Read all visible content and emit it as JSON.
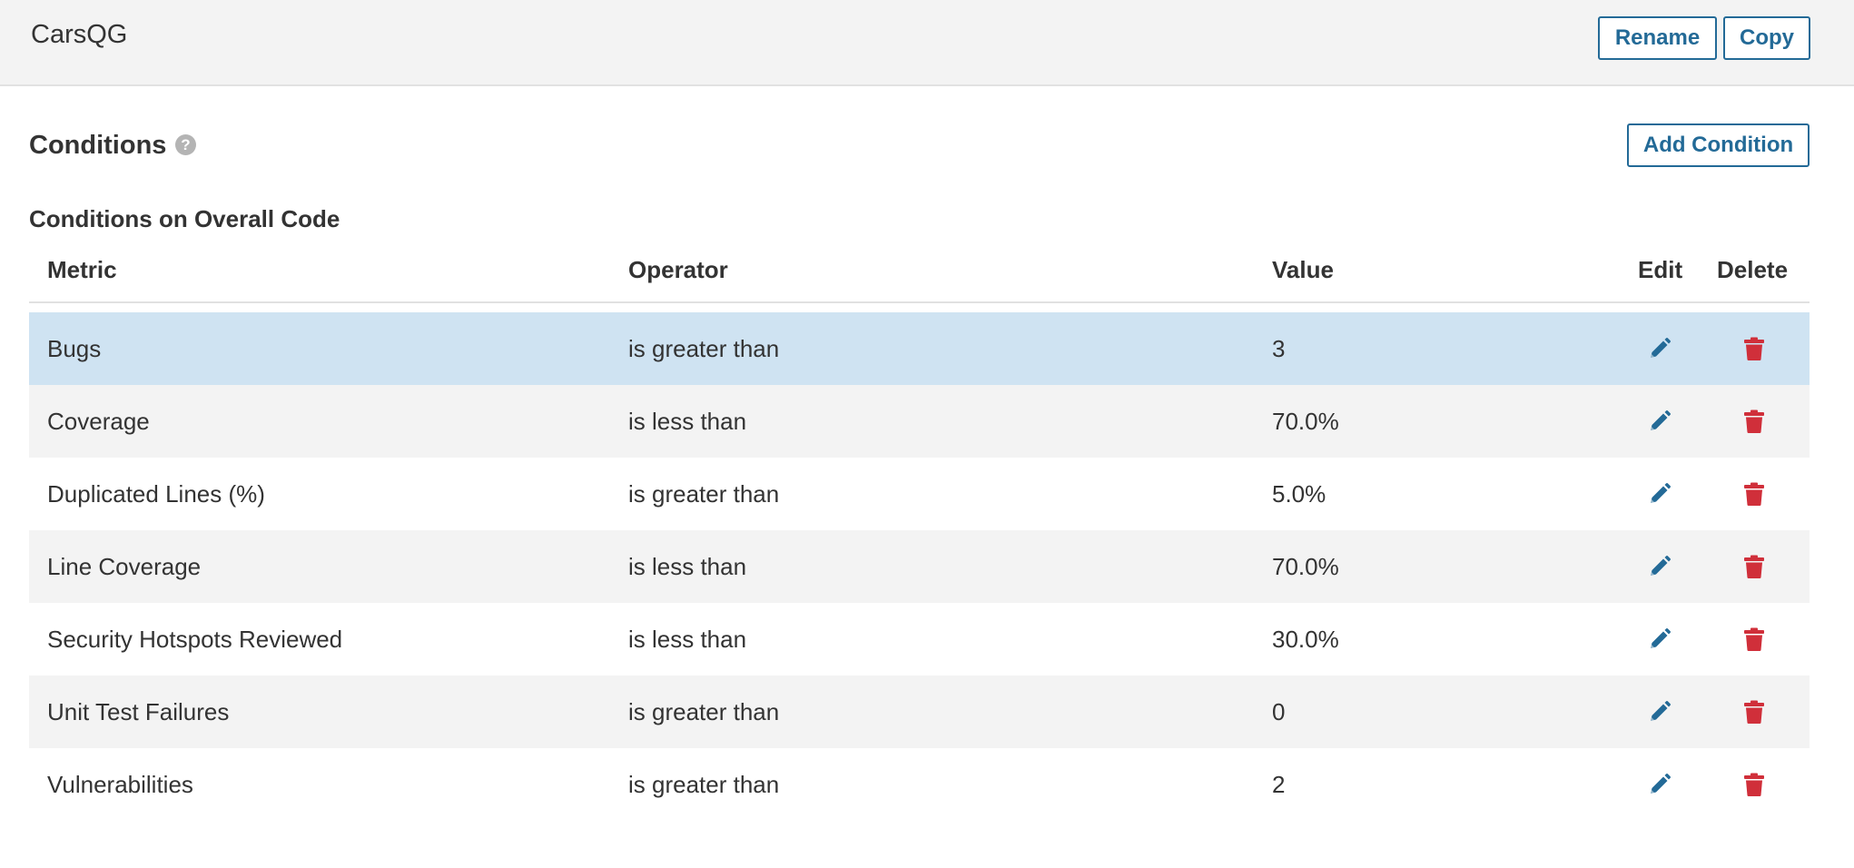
{
  "header": {
    "gate_name": "CarsQG",
    "rename_label": "Rename",
    "copy_label": "Copy"
  },
  "conditions": {
    "title": "Conditions",
    "help_glyph": "?",
    "add_label": "Add Condition",
    "subsection_title": "Conditions on Overall Code",
    "columns": {
      "metric": "Metric",
      "operator": "Operator",
      "value": "Value",
      "edit": "Edit",
      "delete": "Delete"
    },
    "rows": [
      {
        "metric": "Bugs",
        "operator": "is greater than",
        "value": "3"
      },
      {
        "metric": "Coverage",
        "operator": "is less than",
        "value": "70.0%"
      },
      {
        "metric": "Duplicated Lines (%)",
        "operator": "is greater than",
        "value": "5.0%"
      },
      {
        "metric": "Line Coverage",
        "operator": "is less than",
        "value": "70.0%"
      },
      {
        "metric": "Security Hotspots Reviewed",
        "operator": "is less than",
        "value": "30.0%"
      },
      {
        "metric": "Unit Test Failures",
        "operator": "is greater than",
        "value": "0"
      },
      {
        "metric": "Vulnerabilities",
        "operator": "is greater than",
        "value": "2"
      }
    ]
  },
  "icons": {
    "edit": "pencil-icon",
    "delete": "trash-icon",
    "help": "help-icon"
  },
  "colors": {
    "accent": "#236a97",
    "delete": "#d02f3a",
    "selected_row": "#cfe3f2",
    "striped_row": "#f3f3f3"
  }
}
